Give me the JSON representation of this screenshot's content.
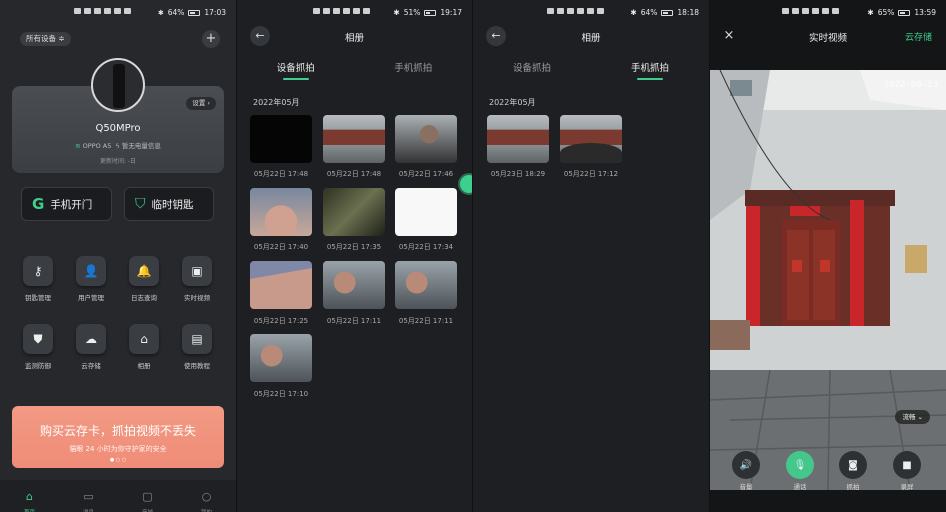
{
  "panel1": {
    "status": {
      "time": "17:03",
      "battery": "64%"
    },
    "device_selector": "所有设备 ≑",
    "add": "+",
    "settings_chip": "设置 ›",
    "device_name": "Q50MPro",
    "phone_model": "OPPO A5",
    "power_info": "暂无电量信息",
    "update_time": "更新时间: -日",
    "btn_open": "手机开门",
    "btn_key": "临时钥匙",
    "grid": [
      "钥匙管理",
      "用户管理",
      "日志查询",
      "实时视频",
      "监测防御",
      "云存储",
      "相册",
      "使用教程"
    ],
    "banner_title": "购买云存卡，抓拍视频不丢失",
    "banner_sub": "猫眼 24 小时为你守护家的安全",
    "nav": [
      "首页",
      "消息",
      "商城",
      "我的"
    ]
  },
  "panel2": {
    "status": {
      "time": "19:17",
      "battery": "51%"
    },
    "title": "相册",
    "tabs": [
      "设备抓拍",
      "手机抓拍"
    ],
    "month": "2022年05月",
    "photos": [
      {
        "time": "05月22日 17:48",
        "scene": "dark"
      },
      {
        "time": "05月22日 17:48",
        "scene": "door"
      },
      {
        "time": "05月22日 17:46",
        "scene": "face2"
      },
      {
        "time": "05月22日 17:40",
        "scene": "hand"
      },
      {
        "time": "05月22日 17:35",
        "scene": "blur"
      },
      {
        "time": "05月22日 17:34",
        "scene": "white"
      },
      {
        "time": "05月22日 17:25",
        "scene": "skin"
      },
      {
        "time": "05月22日 17:11",
        "scene": "face"
      },
      {
        "time": "05月22日 17:11",
        "scene": "face"
      },
      {
        "time": "05月22日 17:10",
        "scene": "face"
      }
    ]
  },
  "panel3": {
    "status": {
      "time": "18:18",
      "battery": "64%"
    },
    "title": "相册",
    "tabs": [
      "设备抓拍",
      "手机抓拍"
    ],
    "month": "2022年05月",
    "photos": [
      {
        "time": "05月23日 18:29",
        "scene": "door"
      },
      {
        "time": "05月22日 17:12",
        "scene": "door"
      }
    ]
  },
  "panel4": {
    "status": {
      "time": "13:59",
      "battery": "65%"
    },
    "close": "×",
    "title": "实时视频",
    "cloud": "云存储",
    "timestamp": "2022-06-23",
    "quality": "流畅 ⌄",
    "controls": [
      "音量",
      "通话",
      "抓拍",
      "录屏"
    ]
  },
  "colors": {
    "accent": "#3ecf8e",
    "banner": "#ef8c77"
  }
}
